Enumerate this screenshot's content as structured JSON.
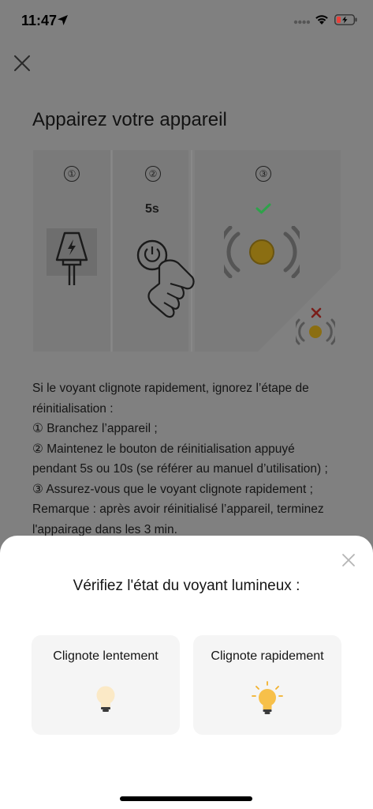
{
  "status_bar": {
    "time": "11:47"
  },
  "header": {
    "title": "Appairez votre appareil"
  },
  "illustration": {
    "steps": [
      "①",
      "②",
      "③"
    ],
    "duration_label": "5s"
  },
  "instructions": {
    "lines": [
      "Si le voyant clignote rapidement, ignorez l’étape de",
      "réinitialisation :",
      "① Branchez l’appareil ;",
      "② Maintenez le bouton de réinitialisation appuyé",
      "pendant 5s ou 10s (se référer au manuel d’utilisation) ;",
      "③ Assurez-vous que le voyant clignote rapidement ;",
      "Remarque : après avoir réinitialisé l’appareil, terminez",
      "l'appairage dans les 3 min."
    ]
  },
  "sheet": {
    "title": "Vérifiez l'état du voyant lumineux :",
    "options": [
      {
        "label": "Clignote lentement"
      },
      {
        "label": "Clignote rapidement"
      }
    ]
  },
  "colors": {
    "check": "#2ea24a",
    "cross": "#d9342b",
    "led": "#f2c230",
    "battery_low": "#e8413a"
  }
}
